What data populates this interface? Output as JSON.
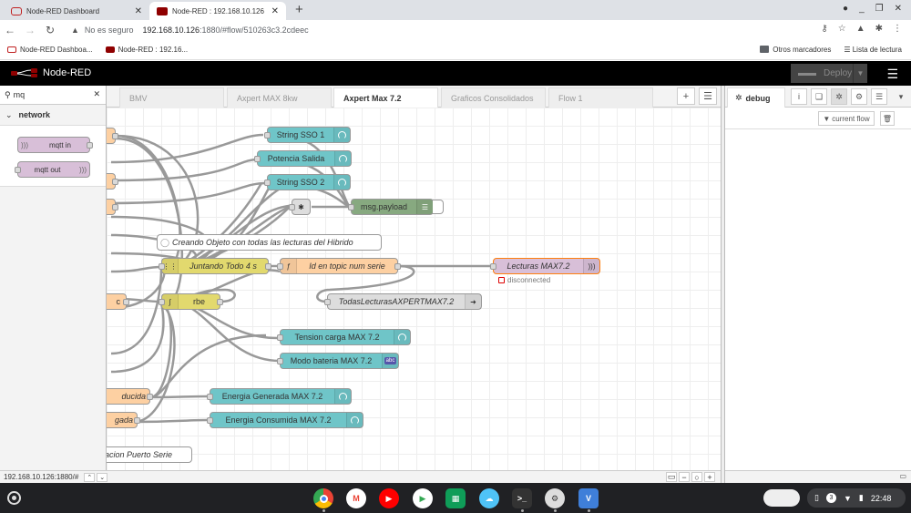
{
  "browser": {
    "tabs": [
      {
        "title": "Node-RED Dashboard",
        "active": false
      },
      {
        "title": "Node-RED : 192.168.10.126",
        "active": true
      }
    ],
    "new_tab": "+",
    "address": {
      "security": "No es seguro",
      "host": "192.168.10.126",
      "path": ":1880/#flow/510263c3.2cdeec"
    },
    "bookmarks": [
      {
        "label": "Node-RED Dashboa..."
      },
      {
        "label": "Node-RED : 192.16..."
      }
    ],
    "other_bookmarks": "Otros marcadores",
    "reading_list": "Lista de lectura"
  },
  "nodered": {
    "brand": "Node-RED",
    "deploy_label": "Deploy",
    "palette": {
      "search_value": "mq",
      "category": "network",
      "nodes": [
        {
          "label": "mqtt in"
        },
        {
          "label": "mqtt out"
        }
      ]
    },
    "workspace_tabs": [
      {
        "label": "BMV",
        "active": false
      },
      {
        "label": "Axpert MAX 8kw",
        "active": false
      },
      {
        "label": "Axpert Max 7.2",
        "active": true
      },
      {
        "label": "Graficos Consolidados",
        "active": false
      },
      {
        "label": "Flow 1",
        "active": false
      }
    ],
    "nodes": {
      "string_sso_1": "String SSO 1",
      "potencia_salida": "Potencia Salida",
      "string_sso_2": "String SSO 2",
      "msg_payload": "msg.payload",
      "comment": "Creando Objeto con todas las lecturas del Hibrido",
      "juntando": "Juntando Todo 4 s",
      "id_topic": "Id en topic num serie",
      "lecturas": "Lecturas MAX7.2",
      "lecturas_status": "disconnected",
      "todas": "TodasLecturasAXPERTMAX7.2",
      "rbe": "rbe",
      "left_c": "c",
      "tension": "Tension carga MAX 7.2",
      "modo": "Modo bateria MAX 7.2",
      "abc_badge": "abc",
      "left_producida": "ducida",
      "energia_generada": "Energia Generada MAX 7.2",
      "left_gada": "gada",
      "energia_consumida": "Energia Consumida MAX 7.2",
      "left_serie": "acion Puerto Serie"
    },
    "sidebar": {
      "tab_label": "debug",
      "filter_label": "current flow"
    },
    "status_url": "192.168.10.126:1880/#"
  },
  "shelf": {
    "time": "22:48",
    "notification_count": "3"
  }
}
